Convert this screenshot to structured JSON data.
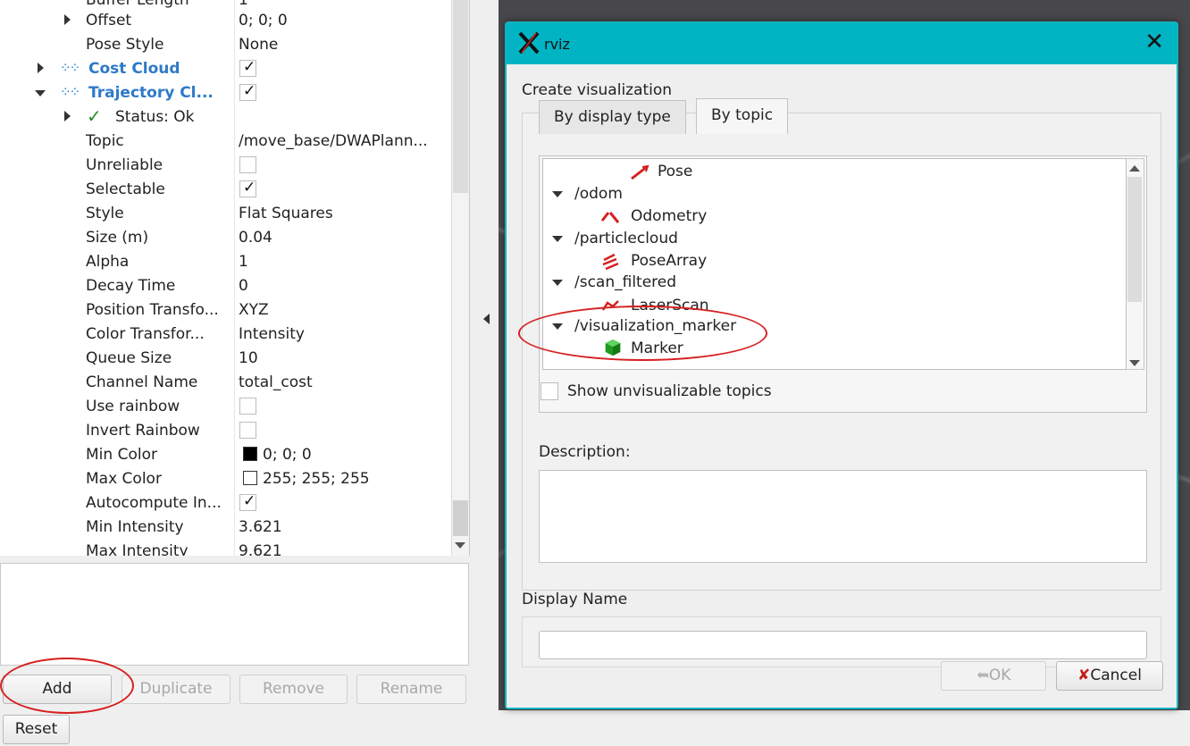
{
  "properties": {
    "rows": [
      {
        "name": "Buffer Length",
        "value": "1"
      },
      {
        "name": "Offset",
        "value": "0; 0; 0"
      },
      {
        "name": "Pose Style",
        "value": "None"
      },
      {
        "name": "Cost Cloud",
        "value": "✓"
      },
      {
        "name": "Trajectory Cl...",
        "value": "✓"
      },
      {
        "name": "Status: Ok",
        "value": ""
      },
      {
        "name": "Topic",
        "value": "/move_base/DWAPlann..."
      },
      {
        "name": "Unreliable",
        "value": ""
      },
      {
        "name": "Selectable",
        "value": "✓"
      },
      {
        "name": "Style",
        "value": "Flat Squares"
      },
      {
        "name": "Size (m)",
        "value": "0.04"
      },
      {
        "name": "Alpha",
        "value": "1"
      },
      {
        "name": "Decay Time",
        "value": "0"
      },
      {
        "name": "Position Transfo...",
        "value": "XYZ"
      },
      {
        "name": "Color Transfor...",
        "value": "Intensity"
      },
      {
        "name": "Queue Size",
        "value": "10"
      },
      {
        "name": "Channel Name",
        "value": "total_cost"
      },
      {
        "name": "Use rainbow",
        "value": ""
      },
      {
        "name": "Invert Rainbow",
        "value": ""
      },
      {
        "name": "Min Color",
        "value": "0; 0; 0"
      },
      {
        "name": "Max Color",
        "value": "255; 255; 255"
      },
      {
        "name": "Autocompute In...",
        "value": "✓"
      },
      {
        "name": "Min Intensity",
        "value": "3.621"
      },
      {
        "name": "Max Intensity",
        "value": "9.621"
      }
    ]
  },
  "buttons": {
    "add": "Add",
    "duplicate": "Duplicate",
    "remove": "Remove",
    "rename": "Rename",
    "reset": "Reset"
  },
  "dialog": {
    "title": "rviz",
    "create_label": "Create visualization",
    "tabs": [
      "By display type",
      "By topic"
    ],
    "tree": [
      {
        "label": "Pose"
      },
      {
        "label": "/odom"
      },
      {
        "label": "Odometry"
      },
      {
        "label": "/particlecloud"
      },
      {
        "label": "PoseArray"
      },
      {
        "label": "/scan_filtered"
      },
      {
        "label": "LaserScan"
      },
      {
        "label": "/visualization_marker"
      },
      {
        "label": "Marker"
      }
    ],
    "show_unvisualizable": "Show unvisualizable topics",
    "description_label": "Description:",
    "display_name_label": "Display Name",
    "display_name_value": "",
    "ok": "OK",
    "cancel": "Cancel"
  },
  "colors": {
    "title_bar": "#00b4c3",
    "annotation": "#d62020",
    "link_blue": "#2d7ac9"
  }
}
